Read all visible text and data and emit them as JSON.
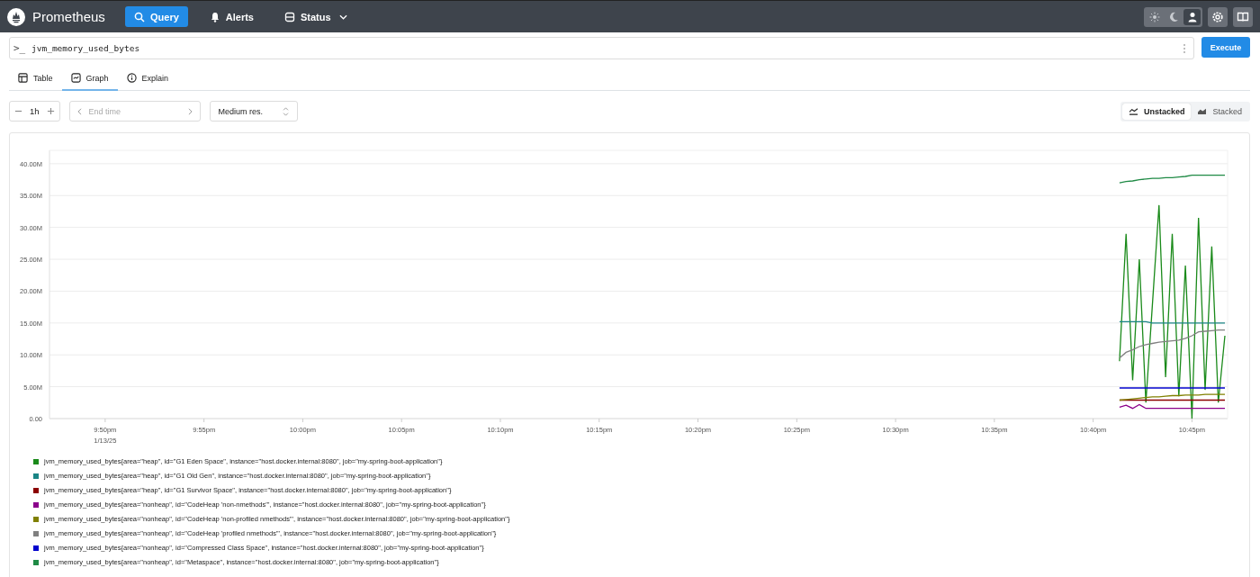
{
  "header": {
    "brand": "Prometheus",
    "nav": [
      {
        "label": "Query",
        "kind": "search",
        "selected": true,
        "dropdown": false
      },
      {
        "label": "Alerts",
        "kind": "bell",
        "selected": false,
        "dropdown": false
      },
      {
        "label": "Status",
        "kind": "status",
        "selected": false,
        "dropdown": true
      }
    ],
    "theme_toggle": [
      {
        "kind": "light",
        "selected": false
      },
      {
        "kind": "dark",
        "selected": false
      },
      {
        "kind": "auto",
        "selected": true
      }
    ]
  },
  "query": {
    "prompt": ">_",
    "value": "jvm_memory_used_bytes",
    "button": "Execute"
  },
  "tabs": [
    {
      "label": "Table",
      "kind": "table",
      "selected": false
    },
    {
      "label": "Graph",
      "kind": "graph",
      "selected": true
    },
    {
      "label": "Explain",
      "kind": "info",
      "selected": false
    }
  ],
  "controls": {
    "range": "1h",
    "end_time_placeholder": "End time",
    "resolution": "Medium res.",
    "stack_modes": [
      {
        "label": "Unstacked",
        "kind": "unstacked",
        "selected": true
      },
      {
        "label": "Stacked",
        "kind": "stacked",
        "selected": false
      }
    ]
  },
  "graph": {
    "chart_data": {
      "type": "line",
      "grid": true,
      "ylim": [
        0,
        42.1
      ],
      "yticks": [
        {
          "value": 0,
          "label": "0.00"
        },
        {
          "value": 5,
          "label": "5.00M"
        },
        {
          "value": 10,
          "label": "10.00M"
        },
        {
          "value": 15,
          "label": "15.00M"
        },
        {
          "value": 20,
          "label": "20.00M"
        },
        {
          "value": 25,
          "label": "25.00M"
        },
        {
          "value": 30,
          "label": "30.00M"
        },
        {
          "value": 35,
          "label": "35.00M"
        },
        {
          "value": 40,
          "label": "40.00M"
        }
      ],
      "annotations": [
        "1/13/25"
      ],
      "categories": [
        null,
        null,
        null,
        null,
        null,
        null,
        null,
        null,
        null,
        "9:50pm",
        null,
        null,
        null,
        null,
        null,
        null,
        null,
        null,
        null,
        null,
        null,
        null,
        null,
        null,
        "9:55pm",
        null,
        null,
        null,
        null,
        null,
        null,
        null,
        null,
        null,
        null,
        null,
        null,
        null,
        null,
        "10:00pm",
        null,
        null,
        null,
        null,
        null,
        null,
        null,
        null,
        null,
        null,
        null,
        null,
        null,
        null,
        "10:05pm",
        null,
        null,
        null,
        null,
        null,
        null,
        null,
        null,
        null,
        null,
        null,
        null,
        null,
        null,
        "10:10pm",
        null,
        null,
        null,
        null,
        null,
        null,
        null,
        null,
        null,
        null,
        null,
        null,
        null,
        null,
        "10:15pm",
        null,
        null,
        null,
        null,
        null,
        null,
        null,
        null,
        null,
        null,
        null,
        null,
        null,
        null,
        "10:20pm",
        null,
        null,
        null,
        null,
        null,
        null,
        null,
        null,
        null,
        null,
        null,
        null,
        null,
        null,
        "10:25pm",
        null,
        null,
        null,
        null,
        null,
        null,
        null,
        null,
        null,
        null,
        null,
        null,
        null,
        null,
        "10:30pm",
        null,
        null,
        null,
        null,
        null,
        null,
        null,
        null,
        null,
        null,
        null,
        null,
        null,
        null,
        "10:35pm",
        null,
        null,
        null,
        null,
        null,
        null,
        null,
        null,
        null,
        null,
        null,
        null,
        null,
        null,
        "10:40pm",
        null,
        null,
        null,
        null,
        null,
        null,
        null,
        null,
        null,
        null,
        null,
        null,
        null,
        null,
        "10:45pm",
        null,
        null,
        null,
        null,
        null
      ],
      "series": [
        {
          "name": "jvm_memory_used_bytes{area=\"heap\", id=\"G1 Eden Space\", instance=\"host.docker.internal:8080\", job=\"my-spring-boot-application\"}",
          "color": "#1a8a1a",
          "values": [
            null,
            null,
            null,
            null,
            null,
            null,
            null,
            null,
            null,
            null,
            null,
            null,
            null,
            null,
            null,
            null,
            null,
            null,
            null,
            null,
            null,
            null,
            null,
            null,
            null,
            null,
            null,
            null,
            null,
            null,
            null,
            null,
            null,
            null,
            null,
            null,
            null,
            null,
            null,
            null,
            null,
            null,
            null,
            null,
            null,
            null,
            null,
            null,
            null,
            null,
            null,
            null,
            null,
            null,
            null,
            null,
            null,
            null,
            null,
            null,
            null,
            null,
            null,
            null,
            null,
            null,
            null,
            null,
            null,
            null,
            null,
            null,
            null,
            null,
            null,
            null,
            null,
            null,
            null,
            null,
            null,
            null,
            null,
            null,
            null,
            null,
            null,
            null,
            null,
            null,
            null,
            null,
            null,
            null,
            null,
            null,
            null,
            null,
            null,
            null,
            null,
            null,
            null,
            null,
            null,
            null,
            null,
            null,
            null,
            null,
            null,
            null,
            null,
            null,
            null,
            null,
            null,
            null,
            null,
            null,
            null,
            null,
            null,
            null,
            null,
            null,
            null,
            null,
            null,
            null,
            null,
            null,
            null,
            null,
            null,
            null,
            null,
            null,
            null,
            null,
            null,
            null,
            null,
            null,
            null,
            null,
            null,
            null,
            null,
            null,
            null,
            null,
            null,
            null,
            null,
            null,
            null,
            null,
            null,
            null,
            null,
            null,
            null,
            9,
            29,
            6,
            25,
            2.5,
            18,
            33.5,
            6.5,
            29,
            3.5,
            24,
            0,
            31.5,
            4.5,
            27,
            2.5,
            13
          ]
        },
        {
          "name": "jvm_memory_used_bytes{area=\"heap\", id=\"G1 Old Gen\", instance=\"host.docker.internal:8080\", job=\"my-spring-boot-application\"}",
          "color": "#1a8585",
          "values": [
            null,
            null,
            null,
            null,
            null,
            null,
            null,
            null,
            null,
            null,
            null,
            null,
            null,
            null,
            null,
            null,
            null,
            null,
            null,
            null,
            null,
            null,
            null,
            null,
            null,
            null,
            null,
            null,
            null,
            null,
            null,
            null,
            null,
            null,
            null,
            null,
            null,
            null,
            null,
            null,
            null,
            null,
            null,
            null,
            null,
            null,
            null,
            null,
            null,
            null,
            null,
            null,
            null,
            null,
            null,
            null,
            null,
            null,
            null,
            null,
            null,
            null,
            null,
            null,
            null,
            null,
            null,
            null,
            null,
            null,
            null,
            null,
            null,
            null,
            null,
            null,
            null,
            null,
            null,
            null,
            null,
            null,
            null,
            null,
            null,
            null,
            null,
            null,
            null,
            null,
            null,
            null,
            null,
            null,
            null,
            null,
            null,
            null,
            null,
            null,
            null,
            null,
            null,
            null,
            null,
            null,
            null,
            null,
            null,
            null,
            null,
            null,
            null,
            null,
            null,
            null,
            null,
            null,
            null,
            null,
            null,
            null,
            null,
            null,
            null,
            null,
            null,
            null,
            null,
            null,
            null,
            null,
            null,
            null,
            null,
            null,
            null,
            null,
            null,
            null,
            null,
            null,
            null,
            null,
            null,
            null,
            null,
            null,
            null,
            null,
            null,
            null,
            null,
            null,
            null,
            null,
            null,
            null,
            null,
            null,
            null,
            null,
            null,
            15.2,
            15.2,
            15.2,
            15.2,
            15.2,
            15.0,
            15.0,
            15.0,
            15.0,
            15.0,
            15.0,
            15.0,
            15.0,
            15.0,
            15.0,
            15.0,
            15.0
          ]
        },
        {
          "name": "jvm_memory_used_bytes{area=\"heap\", id=\"G1 Survivor Space\", instance=\"host.docker.internal:8080\", job=\"my-spring-boot-application\"}",
          "color": "#8b0000",
          "values": [
            null,
            null,
            null,
            null,
            null,
            null,
            null,
            null,
            null,
            null,
            null,
            null,
            null,
            null,
            null,
            null,
            null,
            null,
            null,
            null,
            null,
            null,
            null,
            null,
            null,
            null,
            null,
            null,
            null,
            null,
            null,
            null,
            null,
            null,
            null,
            null,
            null,
            null,
            null,
            null,
            null,
            null,
            null,
            null,
            null,
            null,
            null,
            null,
            null,
            null,
            null,
            null,
            null,
            null,
            null,
            null,
            null,
            null,
            null,
            null,
            null,
            null,
            null,
            null,
            null,
            null,
            null,
            null,
            null,
            null,
            null,
            null,
            null,
            null,
            null,
            null,
            null,
            null,
            null,
            null,
            null,
            null,
            null,
            null,
            null,
            null,
            null,
            null,
            null,
            null,
            null,
            null,
            null,
            null,
            null,
            null,
            null,
            null,
            null,
            null,
            null,
            null,
            null,
            null,
            null,
            null,
            null,
            null,
            null,
            null,
            null,
            null,
            null,
            null,
            null,
            null,
            null,
            null,
            null,
            null,
            null,
            null,
            null,
            null,
            null,
            null,
            null,
            null,
            null,
            null,
            null,
            null,
            null,
            null,
            null,
            null,
            null,
            null,
            null,
            null,
            null,
            null,
            null,
            null,
            null,
            null,
            null,
            null,
            null,
            null,
            null,
            null,
            null,
            null,
            null,
            null,
            null,
            null,
            null,
            null,
            null,
            null,
            null,
            2.9,
            2.9,
            2.9,
            2.9,
            2.9,
            2.9,
            2.9,
            2.9,
            2.9,
            2.9,
            2.9,
            2.9,
            2.9,
            2.9,
            2.9,
            2.9,
            2.9
          ]
        },
        {
          "name": "jvm_memory_used_bytes{area=\"nonheap\", id=\"CodeHeap 'non-nmethods'\", instance=\"host.docker.internal:8080\", job=\"my-spring-boot-application\"}",
          "color": "#8b008b",
          "values": [
            null,
            null,
            null,
            null,
            null,
            null,
            null,
            null,
            null,
            null,
            null,
            null,
            null,
            null,
            null,
            null,
            null,
            null,
            null,
            null,
            null,
            null,
            null,
            null,
            null,
            null,
            null,
            null,
            null,
            null,
            null,
            null,
            null,
            null,
            null,
            null,
            null,
            null,
            null,
            null,
            null,
            null,
            null,
            null,
            null,
            null,
            null,
            null,
            null,
            null,
            null,
            null,
            null,
            null,
            null,
            null,
            null,
            null,
            null,
            null,
            null,
            null,
            null,
            null,
            null,
            null,
            null,
            null,
            null,
            null,
            null,
            null,
            null,
            null,
            null,
            null,
            null,
            null,
            null,
            null,
            null,
            null,
            null,
            null,
            null,
            null,
            null,
            null,
            null,
            null,
            null,
            null,
            null,
            null,
            null,
            null,
            null,
            null,
            null,
            null,
            null,
            null,
            null,
            null,
            null,
            null,
            null,
            null,
            null,
            null,
            null,
            null,
            null,
            null,
            null,
            null,
            null,
            null,
            null,
            null,
            null,
            null,
            null,
            null,
            null,
            null,
            null,
            null,
            null,
            null,
            null,
            null,
            null,
            null,
            null,
            null,
            null,
            null,
            null,
            null,
            null,
            null,
            null,
            null,
            null,
            null,
            null,
            null,
            null,
            null,
            null,
            null,
            null,
            null,
            null,
            null,
            null,
            null,
            null,
            null,
            null,
            null,
            null,
            1.8,
            2.1,
            1.6,
            2.2,
            1.6,
            1.6,
            1.6,
            1.6,
            1.6,
            1.6,
            1.6,
            1.6,
            1.6,
            1.6,
            1.6,
            1.6,
            1.6
          ]
        },
        {
          "name": "jvm_memory_used_bytes{area=\"nonheap\", id=\"CodeHeap 'non-profiled nmethods'\", instance=\"host.docker.internal:8080\", job=\"my-spring-boot-application\"}",
          "color": "#808000",
          "values": [
            null,
            null,
            null,
            null,
            null,
            null,
            null,
            null,
            null,
            null,
            null,
            null,
            null,
            null,
            null,
            null,
            null,
            null,
            null,
            null,
            null,
            null,
            null,
            null,
            null,
            null,
            null,
            null,
            null,
            null,
            null,
            null,
            null,
            null,
            null,
            null,
            null,
            null,
            null,
            null,
            null,
            null,
            null,
            null,
            null,
            null,
            null,
            null,
            null,
            null,
            null,
            null,
            null,
            null,
            null,
            null,
            null,
            null,
            null,
            null,
            null,
            null,
            null,
            null,
            null,
            null,
            null,
            null,
            null,
            null,
            null,
            null,
            null,
            null,
            null,
            null,
            null,
            null,
            null,
            null,
            null,
            null,
            null,
            null,
            null,
            null,
            null,
            null,
            null,
            null,
            null,
            null,
            null,
            null,
            null,
            null,
            null,
            null,
            null,
            null,
            null,
            null,
            null,
            null,
            null,
            null,
            null,
            null,
            null,
            null,
            null,
            null,
            null,
            null,
            null,
            null,
            null,
            null,
            null,
            null,
            null,
            null,
            null,
            null,
            null,
            null,
            null,
            null,
            null,
            null,
            null,
            null,
            null,
            null,
            null,
            null,
            null,
            null,
            null,
            null,
            null,
            null,
            null,
            null,
            null,
            null,
            null,
            null,
            null,
            null,
            null,
            null,
            null,
            null,
            null,
            null,
            null,
            null,
            null,
            null,
            null,
            null,
            null,
            2.9,
            3.0,
            3.1,
            3.2,
            3.3,
            3.4,
            3.4,
            3.5,
            3.6,
            3.6,
            3.7,
            3.7,
            3.7,
            3.8,
            3.8,
            3.8,
            3.8
          ]
        },
        {
          "name": "jvm_memory_used_bytes{area=\"nonheap\", id=\"CodeHeap 'profiled nmethods'\", instance=\"host.docker.internal:8080\", job=\"my-spring-boot-application\"}",
          "color": "#808080",
          "values": [
            null,
            null,
            null,
            null,
            null,
            null,
            null,
            null,
            null,
            null,
            null,
            null,
            null,
            null,
            null,
            null,
            null,
            null,
            null,
            null,
            null,
            null,
            null,
            null,
            null,
            null,
            null,
            null,
            null,
            null,
            null,
            null,
            null,
            null,
            null,
            null,
            null,
            null,
            null,
            null,
            null,
            null,
            null,
            null,
            null,
            null,
            null,
            null,
            null,
            null,
            null,
            null,
            null,
            null,
            null,
            null,
            null,
            null,
            null,
            null,
            null,
            null,
            null,
            null,
            null,
            null,
            null,
            null,
            null,
            null,
            null,
            null,
            null,
            null,
            null,
            null,
            null,
            null,
            null,
            null,
            null,
            null,
            null,
            null,
            null,
            null,
            null,
            null,
            null,
            null,
            null,
            null,
            null,
            null,
            null,
            null,
            null,
            null,
            null,
            null,
            null,
            null,
            null,
            null,
            null,
            null,
            null,
            null,
            null,
            null,
            null,
            null,
            null,
            null,
            null,
            null,
            null,
            null,
            null,
            null,
            null,
            null,
            null,
            null,
            null,
            null,
            null,
            null,
            null,
            null,
            null,
            null,
            null,
            null,
            null,
            null,
            null,
            null,
            null,
            null,
            null,
            null,
            null,
            null,
            null,
            null,
            null,
            null,
            null,
            null,
            null,
            null,
            null,
            null,
            null,
            null,
            null,
            null,
            null,
            null,
            null,
            null,
            null,
            9.5,
            10.4,
            10.8,
            11.3,
            11.6,
            11.8,
            12.0,
            12.1,
            12.2,
            12.3,
            12.6,
            13.0,
            13.6,
            13.7,
            13.8,
            13.9,
            13.9
          ]
        },
        {
          "name": "jvm_memory_used_bytes{area=\"nonheap\", id=\"Compressed Class Space\", instance=\"host.docker.internal:8080\", job=\"my-spring-boot-application\"}",
          "color": "#0000cd",
          "values": [
            null,
            null,
            null,
            null,
            null,
            null,
            null,
            null,
            null,
            null,
            null,
            null,
            null,
            null,
            null,
            null,
            null,
            null,
            null,
            null,
            null,
            null,
            null,
            null,
            null,
            null,
            null,
            null,
            null,
            null,
            null,
            null,
            null,
            null,
            null,
            null,
            null,
            null,
            null,
            null,
            null,
            null,
            null,
            null,
            null,
            null,
            null,
            null,
            null,
            null,
            null,
            null,
            null,
            null,
            null,
            null,
            null,
            null,
            null,
            null,
            null,
            null,
            null,
            null,
            null,
            null,
            null,
            null,
            null,
            null,
            null,
            null,
            null,
            null,
            null,
            null,
            null,
            null,
            null,
            null,
            null,
            null,
            null,
            null,
            null,
            null,
            null,
            null,
            null,
            null,
            null,
            null,
            null,
            null,
            null,
            null,
            null,
            null,
            null,
            null,
            null,
            null,
            null,
            null,
            null,
            null,
            null,
            null,
            null,
            null,
            null,
            null,
            null,
            null,
            null,
            null,
            null,
            null,
            null,
            null,
            null,
            null,
            null,
            null,
            null,
            null,
            null,
            null,
            null,
            null,
            null,
            null,
            null,
            null,
            null,
            null,
            null,
            null,
            null,
            null,
            null,
            null,
            null,
            null,
            null,
            null,
            null,
            null,
            null,
            null,
            null,
            null,
            null,
            null,
            null,
            null,
            null,
            null,
            null,
            null,
            null,
            null,
            null,
            4.8,
            4.8,
            4.8,
            4.8,
            4.8,
            4.8,
            4.8,
            4.8,
            4.8,
            4.8,
            4.8,
            4.8,
            4.8,
            4.8,
            4.8,
            4.8,
            4.8
          ]
        },
        {
          "name": "jvm_memory_used_bytes{area=\"nonheap\", id=\"Metaspace\", instance=\"host.docker.internal:8080\", job=\"my-spring-boot-application\"}",
          "color": "#1f8a45",
          "values": [
            null,
            null,
            null,
            null,
            null,
            null,
            null,
            null,
            null,
            null,
            null,
            null,
            null,
            null,
            null,
            null,
            null,
            null,
            null,
            null,
            null,
            null,
            null,
            null,
            null,
            null,
            null,
            null,
            null,
            null,
            null,
            null,
            null,
            null,
            null,
            null,
            null,
            null,
            null,
            null,
            null,
            null,
            null,
            null,
            null,
            null,
            null,
            null,
            null,
            null,
            null,
            null,
            null,
            null,
            null,
            null,
            null,
            null,
            null,
            null,
            null,
            null,
            null,
            null,
            null,
            null,
            null,
            null,
            null,
            null,
            null,
            null,
            null,
            null,
            null,
            null,
            null,
            null,
            null,
            null,
            null,
            null,
            null,
            null,
            null,
            null,
            null,
            null,
            null,
            null,
            null,
            null,
            null,
            null,
            null,
            null,
            null,
            null,
            null,
            null,
            null,
            null,
            null,
            null,
            null,
            null,
            null,
            null,
            null,
            null,
            null,
            null,
            null,
            null,
            null,
            null,
            null,
            null,
            null,
            null,
            null,
            null,
            null,
            null,
            null,
            null,
            null,
            null,
            null,
            null,
            null,
            null,
            null,
            null,
            null,
            null,
            null,
            null,
            null,
            null,
            null,
            null,
            null,
            null,
            null,
            null,
            null,
            null,
            null,
            null,
            null,
            null,
            null,
            null,
            null,
            null,
            null,
            null,
            null,
            null,
            null,
            null,
            null,
            37.0,
            37.2,
            37.3,
            37.5,
            37.6,
            37.7,
            37.7,
            37.8,
            37.8,
            37.9,
            38.0,
            38.2,
            38.2,
            38.2,
            38.2,
            38.2,
            38.2
          ]
        }
      ]
    }
  }
}
